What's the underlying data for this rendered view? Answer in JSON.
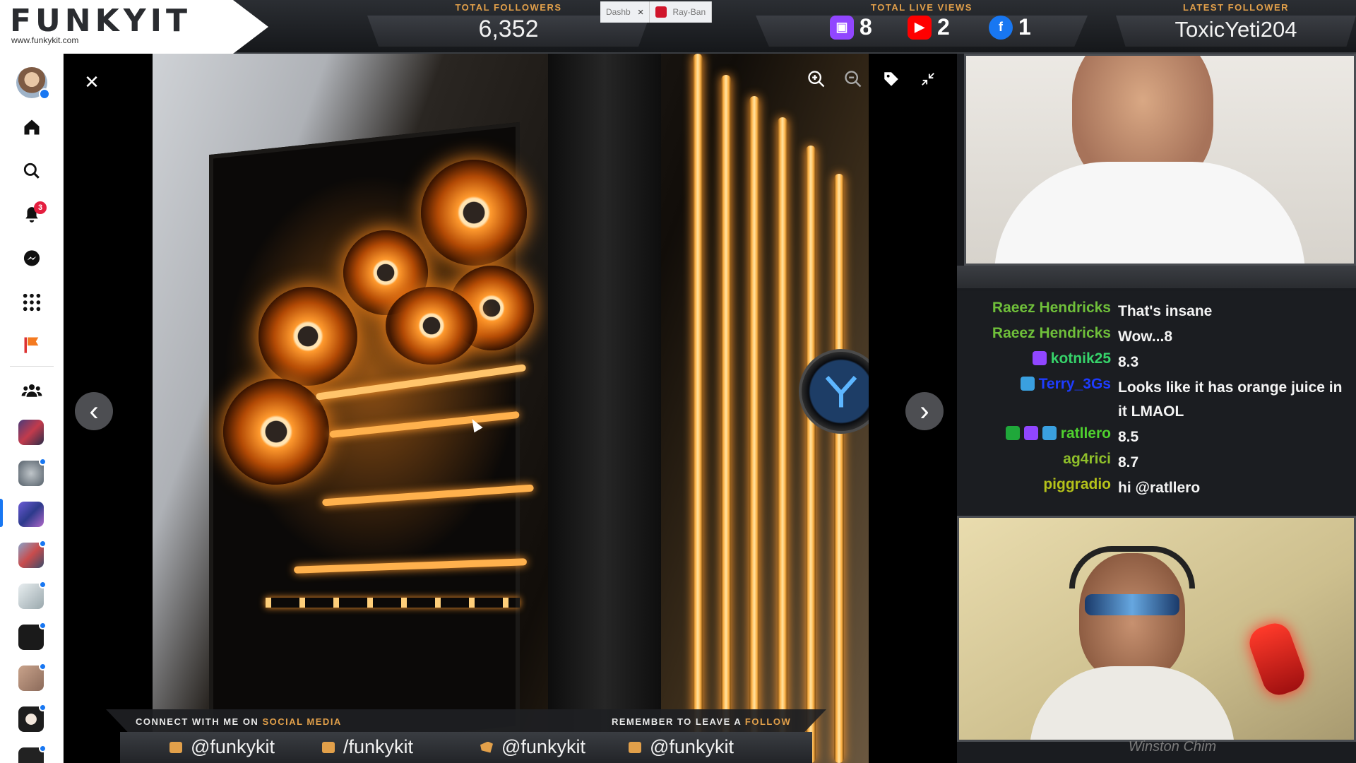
{
  "overlay": {
    "logo_text": "FUNKYIT",
    "logo_url": "www.funkykit.com",
    "total_followers_label": "TOTAL FOLLOWERS",
    "total_followers_value": "6,352",
    "total_live_views_label": "TOTAL LIVE VIEWS",
    "live_views": {
      "twitch": "8",
      "youtube": "2",
      "facebook": "1"
    },
    "latest_follower_label": "LATEST FOLLOWER",
    "latest_follower_value": "ToxicYeti204",
    "colors": {
      "accent": "#e2a04a",
      "twitch": "#9146ff",
      "youtube": "#ff0000",
      "facebook": "#1877f2"
    }
  },
  "browser_tabs": [
    {
      "label": "Dashb",
      "close": "×"
    },
    {
      "label": "Ray-Ban"
    }
  ],
  "sidebar": {
    "items": [
      {
        "name": "profile-avatar"
      },
      {
        "name": "home-icon"
      },
      {
        "name": "search-icon"
      },
      {
        "name": "notifications-icon",
        "badge": "3"
      },
      {
        "name": "messenger-icon"
      },
      {
        "name": "menu-grid-icon"
      },
      {
        "name": "pages-flag-icon"
      },
      {
        "name": "groups-icon"
      }
    ]
  },
  "viewer": {
    "close": "✕",
    "prev": "‹",
    "next": "›"
  },
  "social_banner": {
    "connect_prefix": "CONNECT WITH ME ON ",
    "connect_highlight": "SOCIAL MEDIA",
    "follow_prefix": "REMEMBER TO LEAVE A ",
    "follow_highlight": "FOLLOW",
    "handles": [
      "@funkykit",
      "/funkykit",
      "@funkykit",
      "@funkykit"
    ]
  },
  "chat": {
    "messages": [
      {
        "user": "Raeez Hendricks",
        "text": "That's insane",
        "color": "#6fbf3a"
      },
      {
        "user": "Raeez Hendricks",
        "text": "Wow...8",
        "color": "#6fbf3a"
      },
      {
        "user": "kotnik25",
        "text": "8.3",
        "color": "#36d36a"
      },
      {
        "user": "Terry_3Gs",
        "text": "Looks like it has orange juice in it LMAOL",
        "color": "#1e3cff"
      },
      {
        "user": "ratllero",
        "text": "8.5",
        "color": "#4fd12e"
      },
      {
        "user": "ag4rici",
        "text": "8.7",
        "color": "#8fbf2a"
      },
      {
        "user": "piggradio",
        "text": "hi @ratllero",
        "color": "#b5c21a"
      }
    ]
  },
  "cams": {
    "guest_name": "Winston Chim"
  }
}
